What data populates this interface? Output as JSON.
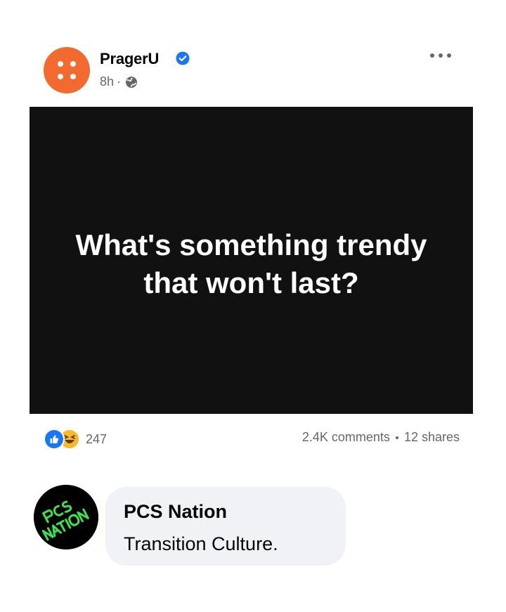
{
  "post": {
    "author": "PragerU",
    "timestamp": "8h",
    "meta_separator": "·",
    "visibility_icon": "globe-icon",
    "verified_icon": "verified-badge-icon",
    "more_icon": "more-options-icon",
    "card_text": "What's something trendy that won't last?",
    "avatar_color": "#f26a2e",
    "card_background": "#111111"
  },
  "stats": {
    "reaction_icons": [
      "like-reaction-icon",
      "haha-reaction-icon"
    ],
    "reaction_count": "247",
    "comments": "2.4K comments",
    "shares": "12 shares"
  },
  "comment": {
    "author": "PCS Nation",
    "text": "Transition Culture.",
    "avatar_logo_text": "PCS NATION",
    "avatar_logo_color": "#3fe24a"
  }
}
